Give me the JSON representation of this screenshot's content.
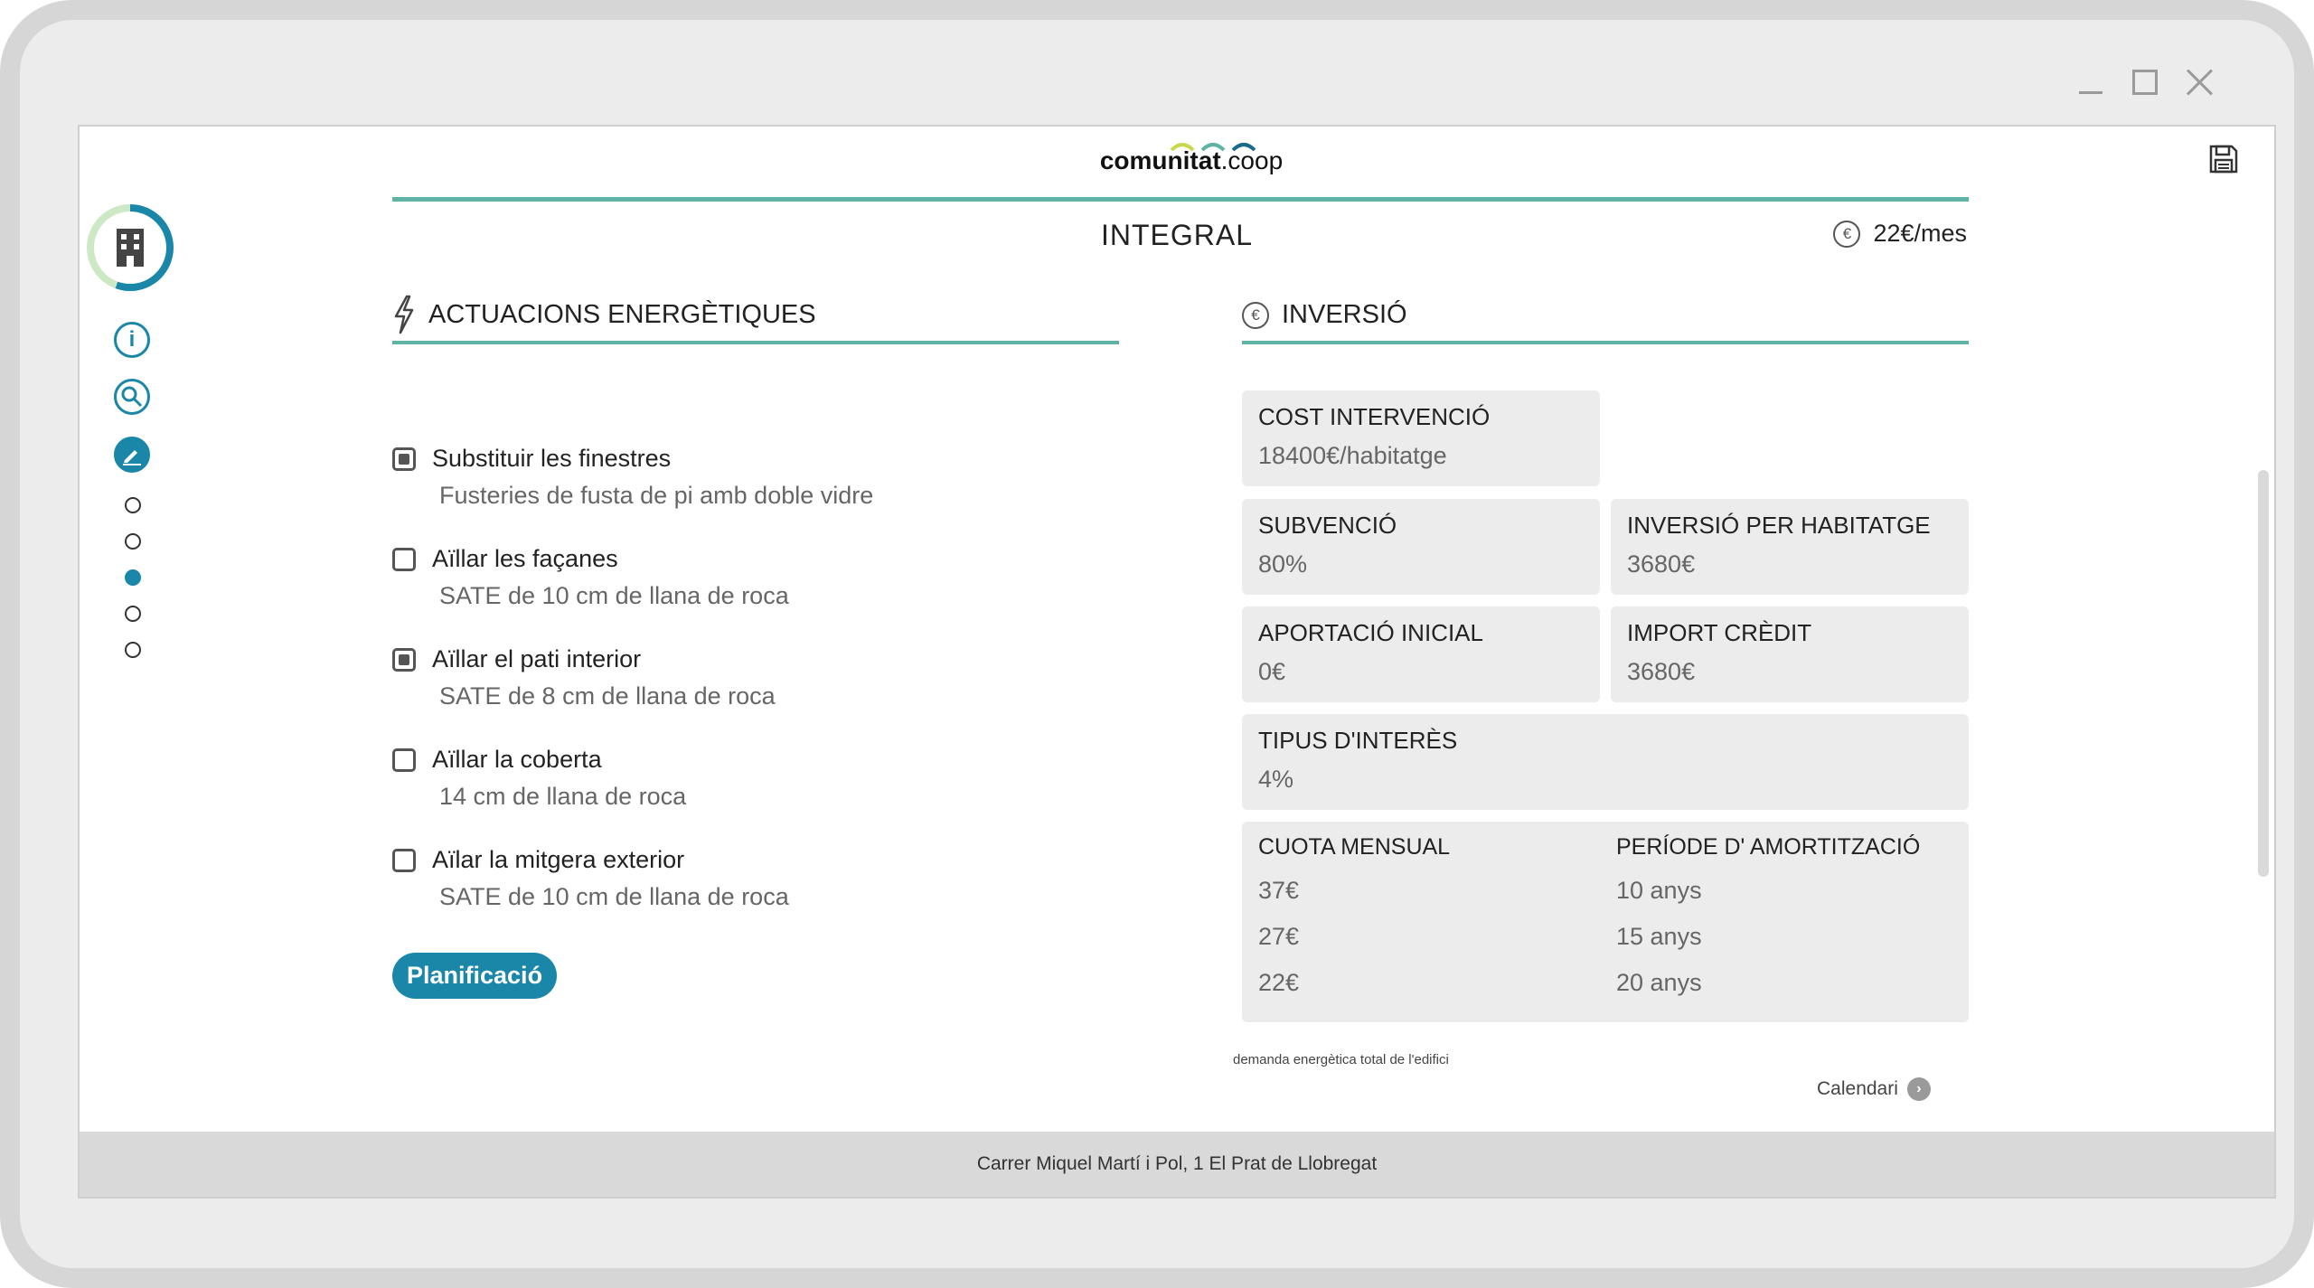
{
  "window": {
    "minimize_icon": "minimize-icon",
    "maximize_icon": "maximize-icon",
    "close_icon": "close-icon"
  },
  "header": {
    "logo_bold": "comunitat",
    "logo_suffix": ".coop",
    "save_icon": "save-icon",
    "title": "INTEGRAL",
    "price": "22€/mes",
    "colors": {
      "accent": "#1b87a8",
      "line": "#5fb3a4"
    }
  },
  "sidebar": {
    "building_icon": "building-icon",
    "icons": [
      "info-icon",
      "search-icon",
      "edit-icon"
    ],
    "step_dots": [
      false,
      false,
      true,
      false,
      false
    ]
  },
  "actions": {
    "heading": "ACTUACIONS ENERGÈTIQUES",
    "items": [
      {
        "title": "Substituir les finestres",
        "detail": "Fusteries de fusta de pi amb doble vidre",
        "checked": true
      },
      {
        "title": "Aïllar les façanes",
        "detail": "SATE de 10 cm de llana de roca",
        "checked": false
      },
      {
        "title": "Aïllar el pati interior",
        "detail": "SATE de 8 cm de llana de roca",
        "checked": true
      },
      {
        "title": "Aïllar la coberta",
        "detail": "14 cm de llana de roca",
        "checked": false
      },
      {
        "title": "Aïlar la mitgera exterior",
        "detail": "SATE de 10 cm de llana de roca",
        "checked": false
      }
    ],
    "plan_button": "Planificació"
  },
  "investment": {
    "heading": "INVERSIÓ",
    "cost": {
      "label": "COST INTERVENCIÓ",
      "value": "18400€/habitatge"
    },
    "subsidy": {
      "label": "SUBVENCIÓ",
      "value": "80%"
    },
    "per_home": {
      "label": "INVERSIÓ PER HABITATGE",
      "value": "3680€"
    },
    "initial": {
      "label": "APORTACIÓ INICIAL",
      "value": "0€"
    },
    "credit": {
      "label": "IMPORT CRÈDIT",
      "value": "3680€"
    },
    "interest": {
      "label": "TIPUS D'INTERÈS",
      "value": "4%"
    },
    "quota": {
      "fee_label": "CUOTA MENSUAL",
      "period_label": "PERÍODE D' AMORTITZACIÓ",
      "fees": [
        "37€",
        "27€",
        "22€"
      ],
      "periods": [
        "10 anys",
        "15 anys",
        "20 anys"
      ]
    },
    "note": "demanda energètica total de l'edifici",
    "calendar_label": "Calendari"
  },
  "footer": {
    "address": "Carrer Miquel Martí i Pol, 1 El Prat de Llobregat"
  }
}
